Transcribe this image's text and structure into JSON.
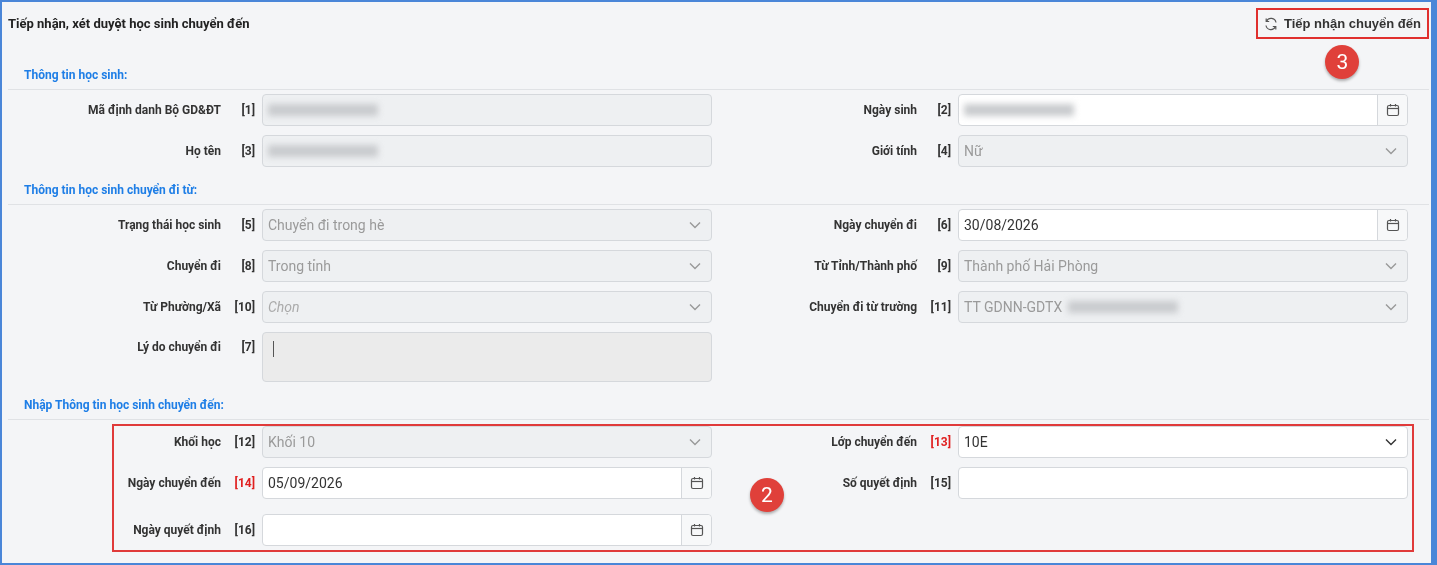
{
  "header": {
    "title": "Tiếp nhận, xét duyệt học sinh chuyển đến",
    "action": {
      "label": "Tiếp nhận chuyển đến",
      "highlighted": true
    },
    "callout": "3"
  },
  "sections": [
    {
      "title": "Thông tin học sinh:",
      "rows": [
        {
          "left": {
            "label": "Mã định danh Bộ GD&ĐT",
            "index": "[1]",
            "required": false,
            "kind": "text",
            "disabled": true,
            "redacted": true
          },
          "right": {
            "label": "Ngày sinh",
            "index": "[2]",
            "required": false,
            "kind": "date",
            "disabled": false,
            "redacted": true
          }
        },
        {
          "left": {
            "label": "Họ tên",
            "index": "[3]",
            "required": false,
            "kind": "text",
            "disabled": true,
            "redacted": true
          },
          "right": {
            "label": "Giới tính",
            "index": "[4]",
            "required": false,
            "kind": "select",
            "disabled": true,
            "value": "Nữ"
          }
        }
      ]
    },
    {
      "title": "Thông tin học sinh chuyển đi từ:",
      "rows": [
        {
          "left": {
            "label": "Trạng thái học sinh",
            "index": "[5]",
            "required": false,
            "kind": "select",
            "disabled": true,
            "value": "Chuyển đi trong hè"
          },
          "right": {
            "label": "Ngày chuyển đi",
            "index": "[6]",
            "required": false,
            "kind": "date",
            "disabled": false,
            "value": "30/08/2026"
          }
        },
        {
          "left": {
            "label": "Chuyển đi",
            "index": "[8]",
            "required": false,
            "kind": "select",
            "disabled": true,
            "value": "Trong tỉnh"
          },
          "right": {
            "label": "Từ Tỉnh/Thành phố",
            "index": "[9]",
            "required": false,
            "kind": "select",
            "disabled": true,
            "value": "Thành phố Hải Phòng"
          }
        },
        {
          "left": {
            "label": "Từ Phường/Xã",
            "index": "[10]",
            "required": false,
            "kind": "select",
            "disabled": true,
            "placeholder": "Chọn"
          },
          "right": {
            "label": "Chuyển đi từ trường",
            "index": "[11]",
            "required": false,
            "kind": "select",
            "disabled": true,
            "value": "TT GDNN-GDTX",
            "redacted": true
          }
        },
        {
          "left": {
            "label": "Lý do chuyển đi",
            "index": "[7]",
            "required": false,
            "kind": "textarea",
            "disabled": true
          }
        }
      ]
    },
    {
      "title": "Nhập Thông tin học sinh chuyển đến:",
      "highlighted": true,
      "callout": "2",
      "rows": [
        {
          "left": {
            "label": "Khối học",
            "index": "[12]",
            "required": false,
            "kind": "select",
            "disabled": true,
            "value": "Khối 10"
          },
          "right": {
            "label": "Lớp chuyển đến",
            "index": "[13]",
            "required": true,
            "kind": "select",
            "disabled": false,
            "value": "10E"
          }
        },
        {
          "left": {
            "label": "Ngày chuyển đến",
            "index": "[14]",
            "required": true,
            "kind": "date",
            "disabled": false,
            "value": "05/09/2026"
          },
          "right": {
            "label": "Số quyết định",
            "index": "[15]",
            "required": false,
            "kind": "text",
            "disabled": false
          }
        },
        {
          "left": {
            "label": "Ngày quyết định",
            "index": "[16]",
            "required": false,
            "kind": "date",
            "disabled": false
          }
        }
      ]
    }
  ]
}
